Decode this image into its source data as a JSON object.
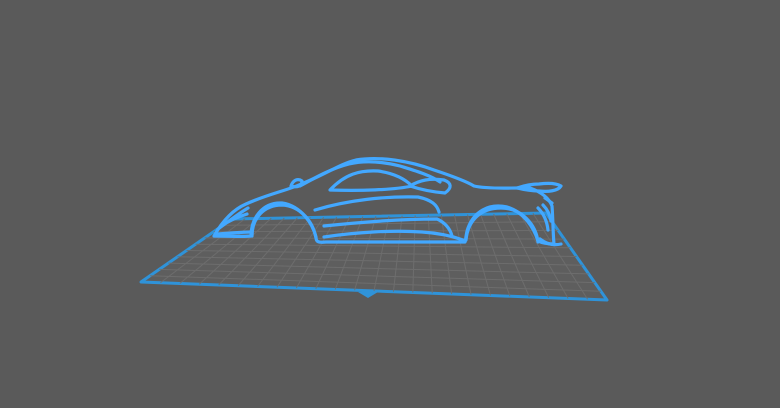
{
  "viewport": {
    "background_color": "#5a5a5a"
  },
  "build_plate": {
    "fill_color": "#5e5e5e",
    "grid_color": "#6f6f6f",
    "border_color": "#2f93d9"
  },
  "model": {
    "icon": "car-silhouette-model",
    "stroke_color": "#43a8ff",
    "shadow_color": "#2b79b8"
  }
}
